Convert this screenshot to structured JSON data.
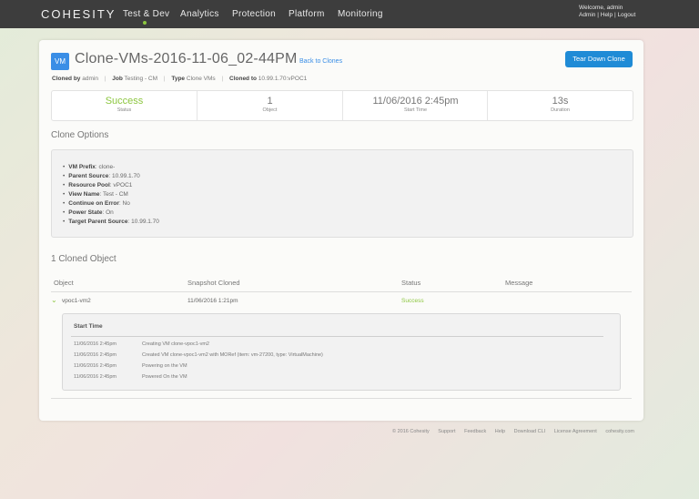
{
  "nav": {
    "logo": "COHESITY",
    "items": [
      {
        "label": "Test & Dev",
        "active": true
      },
      {
        "label": "Analytics"
      },
      {
        "label": "Protection"
      },
      {
        "label": "Platform"
      },
      {
        "label": "Monitoring"
      }
    ],
    "welcome": "Welcome, admin",
    "user_links": [
      "Admin",
      "Help",
      "Logout"
    ]
  },
  "clone": {
    "badge": "VM",
    "title": "Clone-VMs-2016-11-06_02-44PM",
    "back_link": "Back to Clones",
    "tear_down": "Tear Down Clone",
    "meta": {
      "cloned_by_label": "Cloned by",
      "cloned_by": "admin",
      "job_label": "Job",
      "job": "Testing - CM",
      "type_label": "Type",
      "type": "Clone VMs",
      "cloned_to_label": "Cloned to",
      "cloned_to": "10.99.1.70:vPOC1"
    },
    "stats": [
      {
        "value": "Success",
        "label": "Status"
      },
      {
        "value": "1",
        "label": "Object"
      },
      {
        "value": "11/06/2016 2:45pm",
        "label": "Start Time"
      },
      {
        "value": "13s",
        "label": "Duration"
      }
    ]
  },
  "options": {
    "heading": "Clone Options",
    "items": [
      {
        "key": "VM Prefix",
        "value": "clone-"
      },
      {
        "key": "Parent Source",
        "value": "10.99.1.70"
      },
      {
        "key": "Resource Pool",
        "value": "vPOC1"
      },
      {
        "key": "View Name",
        "value": "Test - CM"
      },
      {
        "key": "Continue on Error",
        "value": "No"
      },
      {
        "key": "Power State",
        "value": "On"
      },
      {
        "key": "Target Parent Source",
        "value": "10.99.1.70"
      }
    ]
  },
  "objects": {
    "heading": "1 Cloned Object",
    "columns": [
      "Object",
      "Snapshot Cloned",
      "Status",
      "Message"
    ],
    "rows": [
      {
        "object": "vpoc1-vm2",
        "snapshot": "11/06/2016 1:21pm",
        "status": "Success",
        "message": ""
      }
    ],
    "log": {
      "heading": "Start Time",
      "entries": [
        {
          "time": "11/06/2016 2:45pm",
          "text": "Creating VM clone-vpoc1-vm2"
        },
        {
          "time": "11/06/2016 2:45pm",
          "text": "Created VM clone-vpoc1-vm2 with MORef (item: vm-27200, type: VirtualMachine)"
        },
        {
          "time": "11/06/2016 2:45pm",
          "text": "Powering on the VM"
        },
        {
          "time": "11/06/2016 2:45pm",
          "text": "Powered On the VM"
        }
      ]
    }
  },
  "footer": [
    "© 2016 Cohesity",
    "Support",
    "Feedback",
    "Help",
    "Download CLI",
    "License Agreement",
    "cohesity.com"
  ]
}
